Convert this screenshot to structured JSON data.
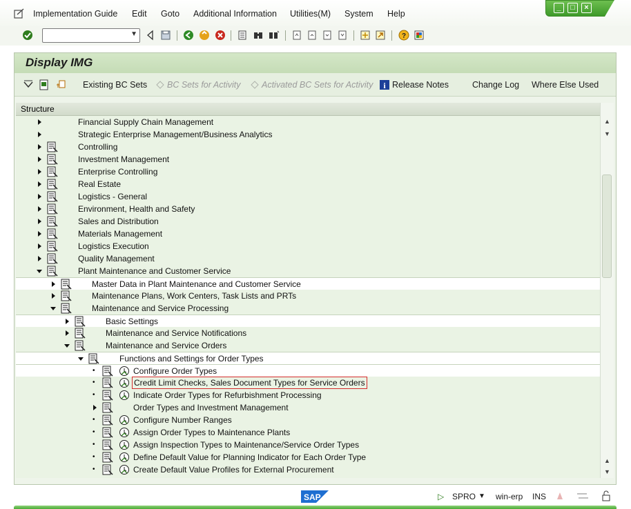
{
  "menu": {
    "items": [
      "Implementation Guide",
      "Edit",
      "Goto",
      "Additional Information",
      "Utilities(M)",
      "System",
      "Help"
    ]
  },
  "window_controls": [
    "minimize",
    "maximize",
    "close"
  ],
  "command_field": {
    "value": ""
  },
  "screen": {
    "title": "Display IMG"
  },
  "app_toolbar": {
    "existing_bc_sets": "Existing BC Sets",
    "bc_sets_activity": "BC Sets for Activity",
    "activated_bc_sets": "Activated BC Sets for Activity",
    "release_notes": "Release Notes",
    "change_log": "Change Log",
    "where_used": "Where Else Used"
  },
  "tree": {
    "header": "Structure",
    "rows": [
      {
        "label": "Financial Supply Chain Management",
        "level": 0,
        "toggle": "collapsed",
        "icon": false,
        "clock": false
      },
      {
        "label": "Strategic Enterprise Management/Business Analytics",
        "level": 0,
        "toggle": "collapsed",
        "icon": false,
        "clock": false
      },
      {
        "label": "Controlling",
        "level": 0,
        "toggle": "collapsed",
        "icon": true,
        "clock": false
      },
      {
        "label": "Investment Management",
        "level": 0,
        "toggle": "collapsed",
        "icon": true,
        "clock": false
      },
      {
        "label": "Enterprise Controlling",
        "level": 0,
        "toggle": "collapsed",
        "icon": true,
        "clock": false
      },
      {
        "label": "Real Estate",
        "level": 0,
        "toggle": "collapsed",
        "icon": true,
        "clock": false
      },
      {
        "label": "Logistics - General",
        "level": 0,
        "toggle": "collapsed",
        "icon": true,
        "clock": false
      },
      {
        "label": "Environment, Health and Safety",
        "level": 0,
        "toggle": "collapsed",
        "icon": true,
        "clock": false
      },
      {
        "label": "Sales and Distribution",
        "level": 0,
        "toggle": "collapsed",
        "icon": true,
        "clock": false
      },
      {
        "label": "Materials Management",
        "level": 0,
        "toggle": "collapsed",
        "icon": true,
        "clock": false
      },
      {
        "label": "Logistics Execution",
        "level": 0,
        "toggle": "collapsed",
        "icon": true,
        "clock": false
      },
      {
        "label": "Quality Management",
        "level": 0,
        "toggle": "collapsed",
        "icon": true,
        "clock": false
      },
      {
        "label": "Plant Maintenance and Customer Service",
        "level": 0,
        "toggle": "expanded",
        "icon": true,
        "clock": false
      },
      {
        "label": "Master Data in Plant Maintenance and Customer Service",
        "level": 1,
        "toggle": "collapsed",
        "icon": true,
        "clock": false
      },
      {
        "label": "Maintenance Plans, Work Centers, Task Lists and PRTs",
        "level": 1,
        "toggle": "collapsed",
        "icon": true,
        "clock": false
      },
      {
        "label": "Maintenance and Service Processing",
        "level": 1,
        "toggle": "expanded",
        "icon": true,
        "clock": false
      },
      {
        "label": "Basic Settings",
        "level": 2,
        "toggle": "collapsed",
        "icon": true,
        "clock": false
      },
      {
        "label": "Maintenance and Service Notifications",
        "level": 2,
        "toggle": "collapsed",
        "icon": true,
        "clock": false
      },
      {
        "label": "Maintenance and Service Orders",
        "level": 2,
        "toggle": "expanded",
        "icon": true,
        "clock": false
      },
      {
        "label": "Functions and Settings for Order Types",
        "level": 3,
        "toggle": "expanded",
        "icon": true,
        "clock": false
      },
      {
        "label": "Configure Order Types",
        "level": 4,
        "toggle": "leaf",
        "icon": true,
        "clock": true
      },
      {
        "label": "Credit Limit Checks, Sales Document Types for Service Orders",
        "level": 4,
        "toggle": "leaf",
        "icon": true,
        "clock": true,
        "selected": true
      },
      {
        "label": "Indicate Order Types for Refurbishment Processing",
        "level": 4,
        "toggle": "leaf",
        "icon": true,
        "clock": true
      },
      {
        "label": "Order Types and Investment Management",
        "level": 4,
        "toggle": "collapsed",
        "icon": true,
        "clock": false
      },
      {
        "label": "Configure Number Ranges",
        "level": 4,
        "toggle": "leaf",
        "icon": true,
        "clock": true
      },
      {
        "label": "Assign Order Types to Maintenance Plants",
        "level": 4,
        "toggle": "leaf",
        "icon": true,
        "clock": true
      },
      {
        "label": "Assign Inspection Types to Maintenance/Service Order Types",
        "level": 4,
        "toggle": "leaf",
        "icon": true,
        "clock": true
      },
      {
        "label": "Define Default Value for Planning Indicator for Each Order Type",
        "level": 4,
        "toggle": "leaf",
        "icon": true,
        "clock": true
      },
      {
        "label": "Create Default Value Profiles for External Procurement",
        "level": 4,
        "toggle": "leaf",
        "icon": true,
        "clock": true
      }
    ]
  },
  "statusbar": {
    "logo": "SAP",
    "transaction": "SPRO",
    "server": "win-erp",
    "mode": "INS"
  },
  "colors": {
    "accent_green": "#49a935",
    "title_bar": "#c5dcb6",
    "selection_outline": "#d32a2a"
  }
}
